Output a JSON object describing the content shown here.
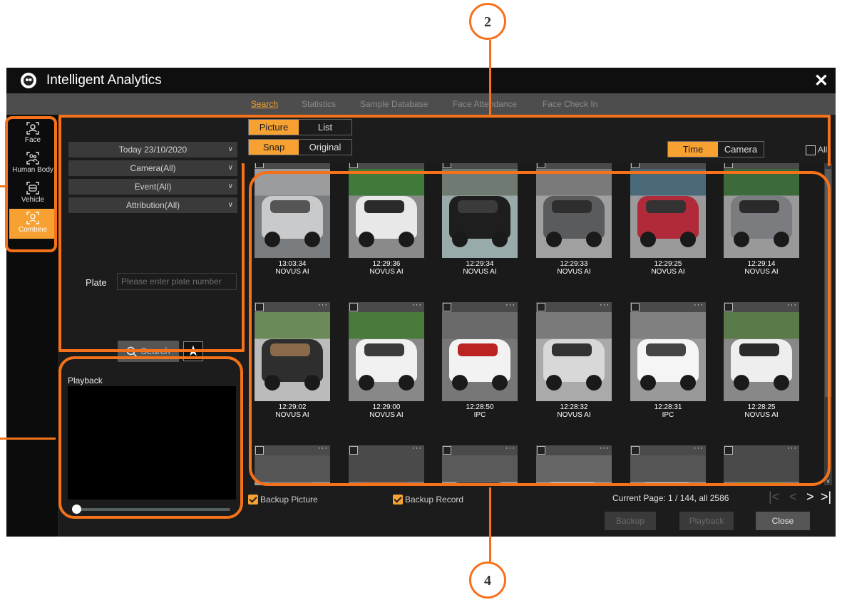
{
  "app": {
    "title": "Intelligent Analytics",
    "close_glyph": "✕"
  },
  "tabs": [
    {
      "label": "Search",
      "active": true
    },
    {
      "label": "Statistics"
    },
    {
      "label": "Sample Database"
    },
    {
      "label": "Face Attendance"
    },
    {
      "label": "Face Check In"
    }
  ],
  "sidebar": [
    {
      "label": "Face",
      "icon": "face-icon"
    },
    {
      "label": "Human Body",
      "icon": "human-body-icon"
    },
    {
      "label": "Vehicle",
      "icon": "vehicle-icon"
    },
    {
      "label": "Combine",
      "icon": "combine-icon",
      "active": true
    }
  ],
  "filters": {
    "date": "Today 23/10/2020",
    "camera": "Camera(All)",
    "event": "Event(All)",
    "attribution": "Attribution(All)",
    "plate_label": "Plate",
    "plate_placeholder": "Please enter plate number",
    "search_label": "Search",
    "playback_label": "Playback"
  },
  "view": {
    "picture": "Picture",
    "list": "List",
    "snap": "Snap",
    "original": "Original",
    "time": "Time",
    "camera": "Camera",
    "all": "All"
  },
  "results": [
    {
      "time": "13:03:34",
      "camera": "NOVUS AI",
      "scene": "silver-car-front"
    },
    {
      "time": "12:29:36",
      "camera": "NOVUS AI",
      "scene": "white-car-side"
    },
    {
      "time": "12:29:34",
      "camera": "NOVUS AI",
      "scene": "black-car"
    },
    {
      "time": "12:29:33",
      "camera": "NOVUS AI",
      "scene": "grey-sedan"
    },
    {
      "time": "12:29:25",
      "camera": "NOVUS AI",
      "scene": "red-car"
    },
    {
      "time": "12:29:14",
      "camera": "NOVUS AI",
      "scene": "grey-suv"
    },
    {
      "time": "12:29:02",
      "camera": "NOVUS AI",
      "scene": "cyclist"
    },
    {
      "time": "12:29:00",
      "camera": "NOVUS AI",
      "scene": "white-car-front"
    },
    {
      "time": "12:28:50",
      "camera": "IPC",
      "scene": "white-van"
    },
    {
      "time": "12:28:32",
      "camera": "NOVUS AI",
      "scene": "truck"
    },
    {
      "time": "12:28:31",
      "camera": "IPC",
      "scene": "white-van-2"
    },
    {
      "time": "12:28:25",
      "camera": "NOVUS AI",
      "scene": "white-car-2"
    },
    {
      "time": "",
      "camera": "",
      "scene": "partial-1"
    },
    {
      "time": "",
      "camera": "",
      "scene": "partial-2"
    },
    {
      "time": "",
      "camera": "",
      "scene": "partial-3"
    },
    {
      "time": "",
      "camera": "",
      "scene": "partial-4"
    },
    {
      "time": "",
      "camera": "",
      "scene": "partial-5"
    },
    {
      "time": "",
      "camera": "",
      "scene": "partial-6"
    }
  ],
  "footer": {
    "backup_picture": "Backup Picture",
    "backup_record": "Backup Record",
    "page_info": "Current Page: 1 / 144, all 2586",
    "backup_btn": "Backup",
    "playback_btn": "Playback",
    "close_btn": "Close"
  },
  "annotations": {
    "two": "2",
    "four": "4"
  },
  "colors": {
    "accent": "#f7a132",
    "annotation": "#f5721a",
    "background": "#1c1c1c"
  }
}
